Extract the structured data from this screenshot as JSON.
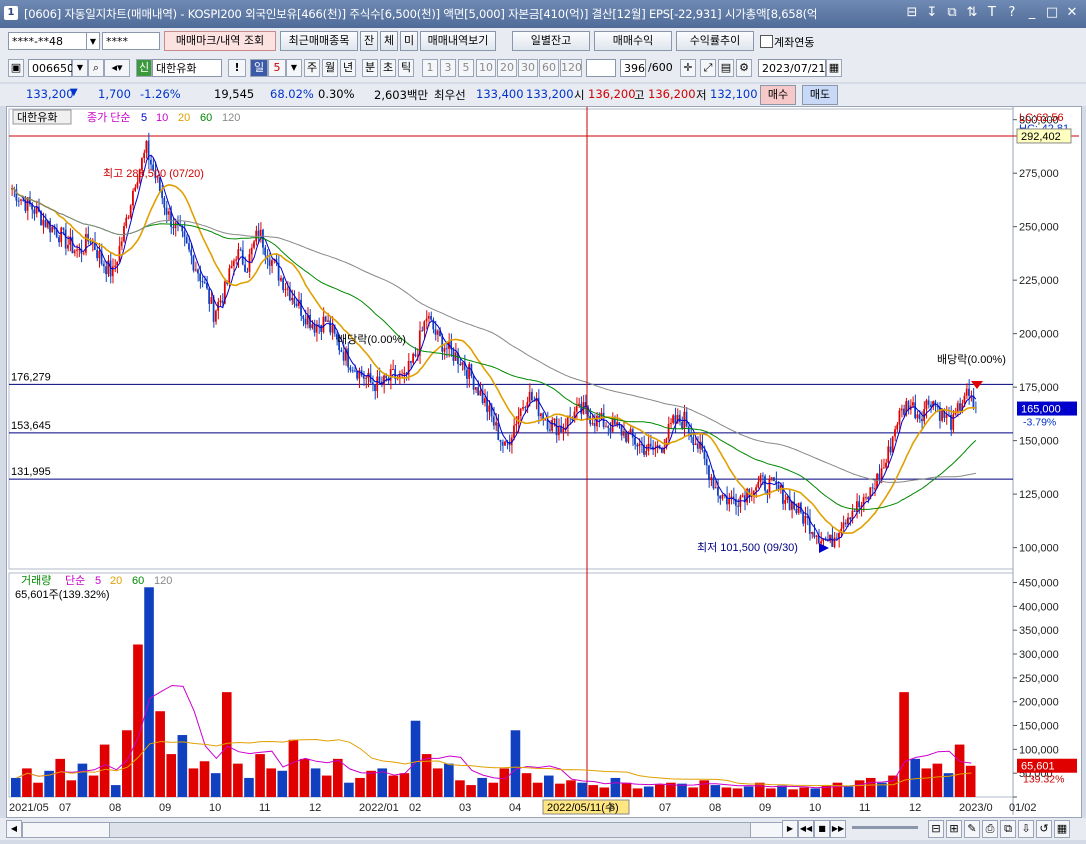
{
  "window": {
    "number": "1",
    "title": "[0606] 자동일지차트(매매내역) - KOSPI200 외국인보유[466(천)] 주식수[6,500(천)] 액면[5,000] 자본금[410(억)] 결산[12월] EPS[-22,931] 시가총액[8,658(억",
    "controls": [
      "⊟",
      "↧",
      "⧉",
      "⇅",
      "T",
      "?",
      "_",
      "□",
      "✕"
    ]
  },
  "toolbar1": {
    "account": "****-**48",
    "password": "****",
    "buttons": [
      "매매마크/내역 조회",
      "최근매매종목",
      "잔",
      "체",
      "미",
      "매매내역보기",
      "일별잔고",
      "매매수익",
      "수익률추이"
    ],
    "checkbox_label": "계좌연동"
  },
  "toolbar2": {
    "code": "006650",
    "credit_badge": "신",
    "stock_name": "대한유화",
    "period_units": [
      "일",
      "5",
      "주",
      "월",
      "년",
      "분",
      "초",
      "틱"
    ],
    "intervals": [
      "1",
      "3",
      "5",
      "10",
      "20",
      "30",
      "60",
      "120"
    ],
    "count": "396",
    "count_total": "/600",
    "date": "2023/07/21"
  },
  "quote": {
    "price": "133,200",
    "arrow": "▼",
    "change": "1,700",
    "change_pct": "-1.26%",
    "volume": "19,545",
    "vol_ratio": "68.02%",
    "turnover": "0.30%",
    "amount": "2,603백만",
    "best_label": "최우선",
    "best_ask": "133,400",
    "best_bid": "133,200",
    "open_label": "시",
    "open": "136,200",
    "high_label": "고",
    "high": "136,200",
    "low_label": "저",
    "low": "132,100",
    "buy": "매수",
    "sell": "매도"
  },
  "chart_data": [
    {
      "type": "candlestick",
      "name": "price",
      "legend": {
        "stock": "대한유화",
        "title": "종가 단순",
        "ma": [
          "5",
          "10",
          "20",
          "60",
          "120"
        ]
      },
      "ma_colors": [
        "#0000cc",
        "#cc00cc",
        "#e0a000",
        "#008800",
        "#888888"
      ],
      "lc_label": "LC:62.56",
      "hc_label": "HC:-42.81",
      "ylim": [
        90000,
        305000
      ],
      "y_ticks": [
        100000,
        125000,
        150000,
        175000,
        200000,
        225000,
        250000,
        275000,
        300000
      ],
      "y_tick_labels": [
        "100,000",
        "125,000",
        "150,000",
        "175,000",
        "200,000",
        "225,000",
        "250,000",
        "275,000",
        "300,000"
      ],
      "hlines": [
        {
          "value": 292402,
          "label": "292,402",
          "color": "#cc0000",
          "label_side": "right"
        },
        {
          "value": 176279,
          "label": "176,279",
          "color": "#000080",
          "label_side": "left"
        },
        {
          "value": 153645,
          "label": "153,645",
          "color": "#000080",
          "label_side": "left"
        },
        {
          "value": 131995,
          "label": "131,995",
          "color": "#000080",
          "label_side": "left"
        }
      ],
      "current": {
        "value": 165000,
        "label": "165,000",
        "pct": "-3.79%"
      },
      "annotations": [
        {
          "text": "최고 288,500 (07/20)",
          "color": "#cc0000"
        },
        {
          "text": "배당락(0.00%)",
          "color": "#000000"
        },
        {
          "text": "배당락(0.00%)",
          "color": "#000000"
        },
        {
          "text": "최저 101,500 (09/30)",
          "color": "#000080"
        }
      ],
      "x_labels": [
        "2021/05",
        "07",
        "08",
        "09",
        "10",
        "11",
        "12",
        "2022/01",
        "02",
        "03",
        "04",
        "2022/05/11(수)",
        "6",
        "07",
        "08",
        "09",
        "10",
        "11",
        "12",
        "2023/0",
        "01/02"
      ],
      "cursor_date": "2022/05/11(수)",
      "close_path": [
        268000,
        262000,
        258000,
        252000,
        248000,
        242000,
        238000,
        245000,
        234000,
        228000,
        248000,
        272000,
        286000,
        270000,
        255000,
        246000,
        236000,
        225000,
        210000,
        220000,
        238000,
        232000,
        248000,
        236000,
        226000,
        218000,
        210000,
        204000,
        206000,
        196000,
        188000,
        182000,
        177000,
        176000,
        180000,
        178000,
        190000,
        208000,
        198000,
        192000,
        188000,
        180000,
        170000,
        158000,
        146000,
        160000,
        172000,
        165000,
        158000,
        156000,
        162000,
        164000,
        160000,
        158000,
        156000,
        152000,
        148000,
        145000,
        148000,
        158000,
        160000,
        150000,
        138000,
        126000,
        122000,
        124000,
        128000,
        130000,
        128000,
        124000,
        118000,
        112000,
        106000,
        102000,
        112000,
        118000,
        120000,
        130000,
        140000,
        160000,
        168000,
        162000,
        170000,
        162000,
        158000,
        172000,
        165000
      ]
    },
    {
      "type": "bar",
      "name": "volume",
      "legend": {
        "title": "거래량",
        "sub": "단순",
        "ma": [
          "5",
          "20",
          "60",
          "120"
        ]
      },
      "header_value": "65,601주(139.32%)",
      "ylim": [
        0,
        470000
      ],
      "y_ticks": [
        0,
        50000,
        100000,
        150000,
        200000,
        250000,
        300000,
        350000,
        400000,
        450000
      ],
      "y_tick_labels": [
        "",
        "50,000",
        "100,000",
        "150,000",
        "200,000",
        "250,000",
        "300,000",
        "350,000",
        "400,000",
        "450,000"
      ],
      "current": {
        "value": 65601,
        "label": "65,601",
        "pct": "139.32%"
      },
      "bars": [
        40000,
        60000,
        30000,
        55000,
        80000,
        35000,
        70000,
        45000,
        110000,
        25000,
        140000,
        320000,
        440000,
        180000,
        90000,
        130000,
        60000,
        75000,
        50000,
        220000,
        70000,
        40000,
        90000,
        60000,
        55000,
        120000,
        80000,
        60000,
        45000,
        80000,
        30000,
        40000,
        55000,
        60000,
        45000,
        50000,
        160000,
        90000,
        60000,
        70000,
        35000,
        25000,
        40000,
        30000,
        60000,
        140000,
        50000,
        30000,
        45000,
        28000,
        35000,
        30000,
        25000,
        20000,
        40000,
        30000,
        18000,
        22000,
        26000,
        30000,
        28000,
        20000,
        35000,
        25000,
        20000,
        18000,
        22000,
        30000,
        18000,
        24000,
        16000,
        20000,
        18000,
        25000,
        30000,
        22000,
        35000,
        40000,
        30000,
        45000,
        220000,
        80000,
        60000,
        70000,
        50000,
        110000,
        65601
      ]
    }
  ],
  "scroll": {
    "controls": [
      "◀◀",
      "▶▶",
      "■",
      "▶▶"
    ]
  }
}
